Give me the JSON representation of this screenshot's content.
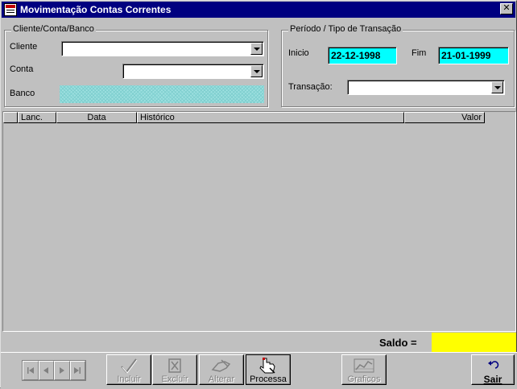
{
  "window": {
    "title": "Movimentação Contas Correntes",
    "close_glyph": "✕"
  },
  "cliente_group": {
    "legend": "Cliente/Conta/Banco",
    "cliente_label": "Cliente",
    "conta_label": "Conta",
    "banco_label": "Banco",
    "cliente_value": "",
    "conta_value": ""
  },
  "periodo_group": {
    "legend": "Período / Tipo de Transação",
    "inicio_label": "Inicio",
    "inicio_value": "22-12-1998",
    "fim_label": "Fim",
    "fim_value": "21-01-1999",
    "transacao_label": "Transação:",
    "transacao_value": ""
  },
  "grid": {
    "columns": [
      "Lanc.",
      "Data",
      "Histórico",
      "Valor"
    ],
    "rows": []
  },
  "saldo": {
    "label": "Saldo  =",
    "value": ""
  },
  "toolbar": {
    "incluir": "Incluir",
    "excluir": "Excluir",
    "alterar": "Alterar",
    "processa": "Processa",
    "graficos": "Graficos",
    "sair": "Sair"
  },
  "colors": {
    "title_bar": "#000080",
    "date_bg": "#00ffff",
    "saldo_bg": "#ffff00",
    "face": "#c0c0c0"
  },
  "icons": [
    "app-icon",
    "close-icon",
    "first-record-icon",
    "prev-record-icon",
    "next-record-icon",
    "last-record-icon",
    "check-icon",
    "delete-icon",
    "edit-hand-icon",
    "process-hand-icon",
    "chart-icon",
    "exit-arrow-icon"
  ]
}
